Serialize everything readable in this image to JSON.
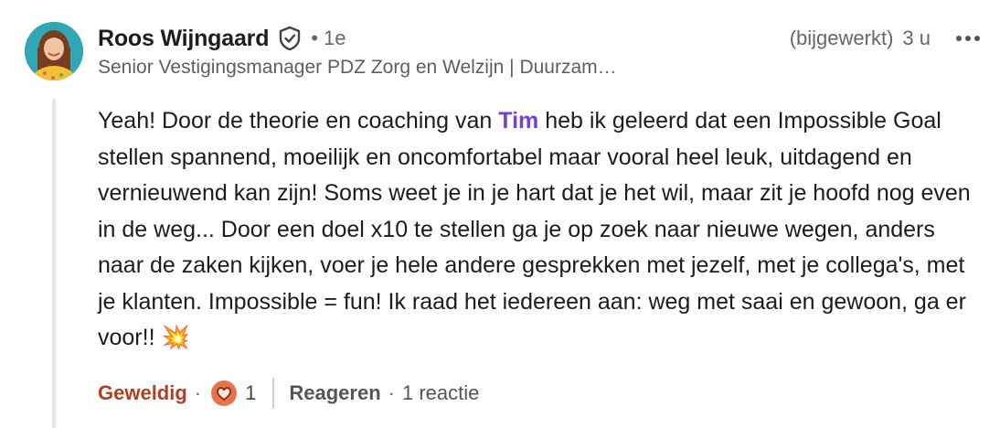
{
  "comment": {
    "author_name": "Roos Wijngaard",
    "connection_dot": "•",
    "connection_degree": "1e",
    "edited_label": "(bijgewerkt)",
    "time_ago": "3 u",
    "headline": "Senior Vestigingsmanager PDZ Zorg en Welzijn | Duurzam…",
    "body_before_mention": "Yeah! Door de theorie en coaching van ",
    "mention": "Tim",
    "body_after_mention": " heb ik geleerd dat een Impossible Goal stellen spannend, moeilijk en oncomfortabel maar vooral heel leuk, uitdagend en vernieuwend kan zijn! Soms weet je in je hart dat je het wil, maar zit je hoofd nog even in de weg... Door een doel x10 te stellen ga je op zoek naar nieuwe wegen, anders naar de zaken kijken, voer je hele andere gesprekken met jezelf, met je collega's, met je klanten. Impossible = fun! Ik raad het iedereen aan: weg met saai en gewoon, ga er voor!! 💥"
  },
  "actions": {
    "reaction_label": "Geweldig",
    "dot": "·",
    "reaction_count": "1",
    "reply_label": "Reageren",
    "reply_count": "1 reactie"
  },
  "icons": {
    "verified": "verified-shield-icon",
    "more": "more-horizontal-icon",
    "reaction": "heart-reaction-icon"
  },
  "colors": {
    "mention": "#7a3ed0",
    "reaction_label": "#b24020",
    "reaction_icon_bg": "#e8734a"
  }
}
